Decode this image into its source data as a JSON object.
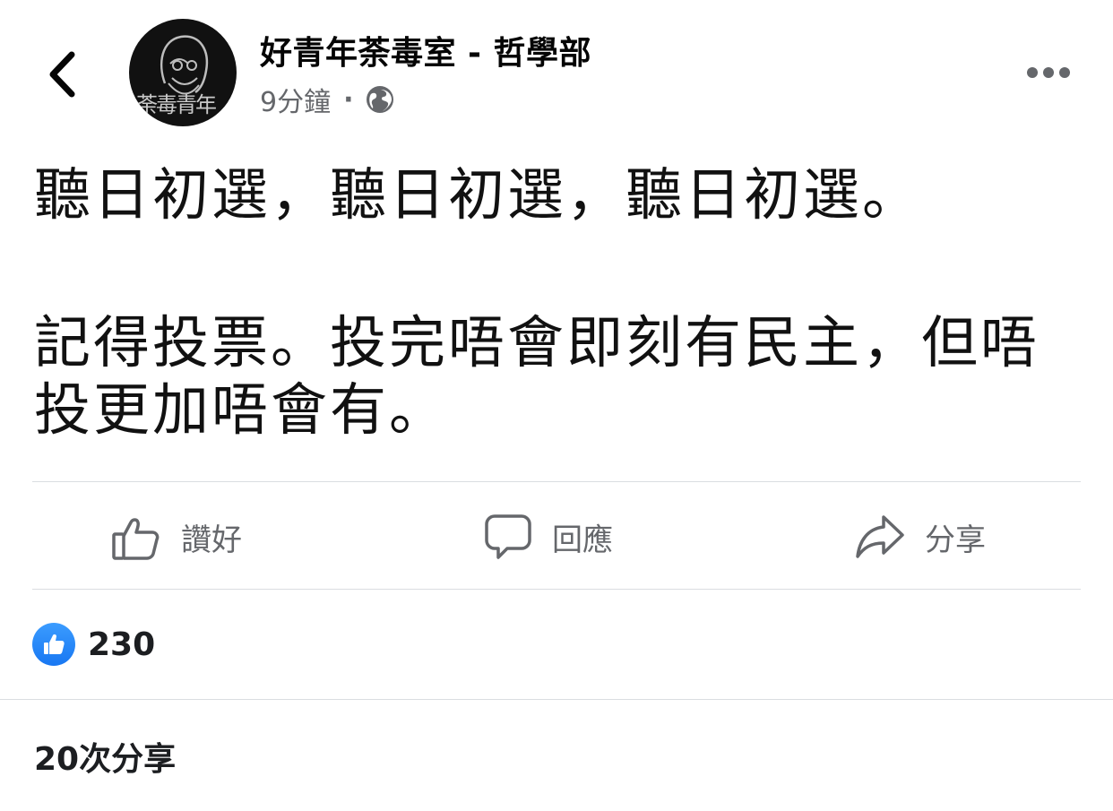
{
  "header": {
    "page_name": "好青年荼毒室 - 哲學部",
    "timestamp": "9分鐘",
    "separator": "·",
    "avatar_text": "荼毒青年",
    "back_icon": "chevron-left-icon",
    "privacy_icon": "globe-icon",
    "more_icon": "more-horizontal-icon"
  },
  "post": {
    "paragraphs": [
      "聽日初選，聽日初選，聽日初選。",
      "記得投票。投完唔會即刻有民主，但唔投更加唔會有。"
    ]
  },
  "actions": {
    "like_label": "讚好",
    "comment_label": "回應",
    "share_label": "分享"
  },
  "stats": {
    "reaction_count": "230",
    "shares_text": "20次分享"
  },
  "colors": {
    "like_blue": "#1877f2",
    "secondary_text": "#65676b",
    "divider": "#dadde1"
  }
}
